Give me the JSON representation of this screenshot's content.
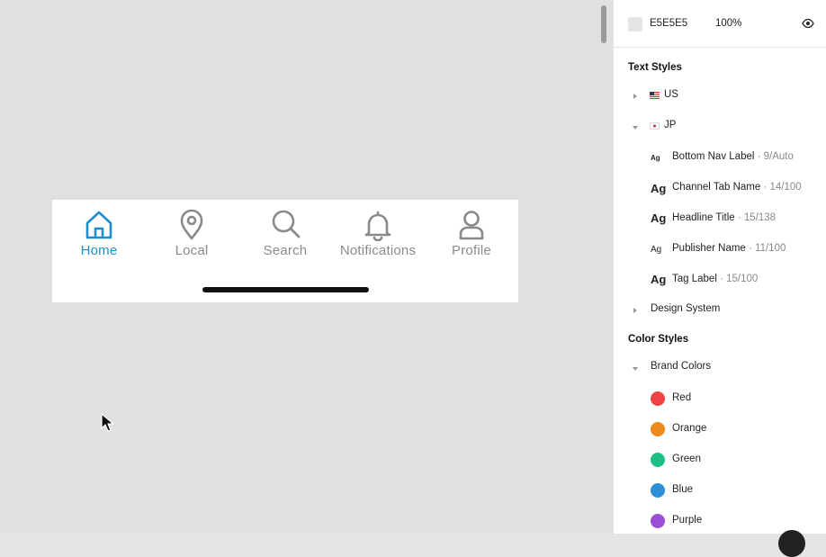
{
  "canvas": {
    "background": "#E0E0DF",
    "nav_bar": {
      "items": [
        {
          "label": "Home",
          "icon": "home-icon",
          "active": true
        },
        {
          "label": "Local",
          "icon": "location-pin-icon",
          "active": false
        },
        {
          "label": "Search",
          "icon": "search-icon",
          "active": false
        },
        {
          "label": "Notifications",
          "icon": "bell-icon",
          "active": false
        },
        {
          "label": "Profile",
          "icon": "user-icon",
          "active": false
        }
      ],
      "active_color": "#1D8FD0",
      "inactive_color": "#8A8A8A"
    }
  },
  "panel": {
    "fill": {
      "hex": "E5E5E5",
      "opacity": "100%"
    },
    "text_styles": {
      "title": "Text Styles",
      "groups": [
        {
          "label": "US",
          "expanded": false
        },
        {
          "label": "JP",
          "expanded": true
        },
        {
          "label": "Design System",
          "expanded": false
        }
      ],
      "styles": [
        {
          "ag": "Ag",
          "name": "Bottom Nav Label",
          "meta": " · 9/Auto"
        },
        {
          "ag": "Ag",
          "name": "Channel Tab Name",
          "meta": " · 14/100"
        },
        {
          "ag": "Ag",
          "name": "Headline Title",
          "meta": " · 15/138"
        },
        {
          "ag": "Ag",
          "name": "Publisher Name",
          "meta": " · 11/100"
        },
        {
          "ag": "Ag",
          "name": "Tag Label",
          "meta": " · 15/100"
        }
      ]
    },
    "color_styles": {
      "title": "Color Styles",
      "group": "Brand Colors",
      "colors": [
        {
          "name": "Red",
          "hex": "#EE4444"
        },
        {
          "name": "Orange",
          "hex": "#F08A1C"
        },
        {
          "name": "Green",
          "hex": "#1EBF83"
        },
        {
          "name": "Blue",
          "hex": "#2C8FD8"
        },
        {
          "name": "Purple",
          "hex": "#9A4FD6"
        }
      ]
    }
  }
}
